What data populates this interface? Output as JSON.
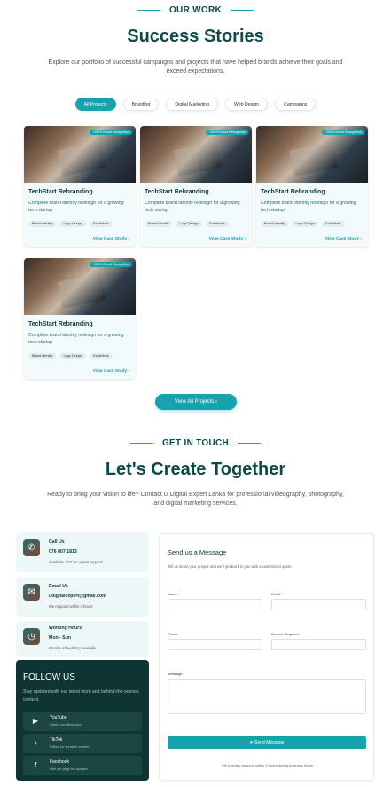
{
  "work": {
    "eyebrow": "OUR WORK",
    "title": "Success Stories",
    "lead": "Explore our portfolio of successful campaigns and projects that have helped brands achieve their goals and exceed expectations."
  },
  "filters": [
    "All Projects",
    "Branding",
    "Digital Marketing",
    "Web Design",
    "Campaigns"
  ],
  "cards": [
    {
      "tag": "+150% Brand Recognition",
      "title": "TechStart Rebranding",
      "desc": "Complete brand identity redesign for a growing tech startup",
      "chips": [
        "Brand Identity",
        "Logo Design",
        "Guidelines"
      ],
      "link": "View Case Study ›"
    },
    {
      "tag": "+150% Brand Recognition",
      "title": "TechStart Rebranding",
      "desc": "Complete brand identity redesign for a growing tech startup",
      "chips": [
        "Brand Identity",
        "Logo Design",
        "Guidelines"
      ],
      "link": "View Case Study ›"
    },
    {
      "tag": "+150% Brand Recognition",
      "title": "TechStart Rebranding",
      "desc": "Complete brand identity redesign for a growing tech startup",
      "chips": [
        "Brand Identity",
        "Logo Design",
        "Guidelines"
      ],
      "link": "View Case Study ›"
    },
    {
      "tag": "+150% Brand Recognition",
      "title": "TechStart Rebranding",
      "desc": "Complete brand identity redesign for a growing tech startup",
      "chips": [
        "Brand Identity",
        "Logo Design",
        "Guidelines"
      ],
      "link": "View Case Study ›"
    }
  ],
  "view_all": "View All Projects ›",
  "contact": {
    "eyebrow": "GET IN TOUCH",
    "title": "Let's Create Together",
    "lead": "Ready to bring your vision to life? Contact U Digital Expert Lanka for professional videography, photography, and digital marketing services."
  },
  "info": [
    {
      "icon": "phone-icon",
      "glyph": "✆",
      "title": "Call Us",
      "value": "076 807 1813",
      "sub": "Available 24/7 for urgent projects"
    },
    {
      "icon": "mail-icon",
      "glyph": "✉",
      "title": "Email Us",
      "value": "udigitalexpert@gmail.com",
      "sub": "We respond within 2 hours"
    },
    {
      "icon": "clock-icon",
      "glyph": "◷",
      "title": "Working Hours",
      "value": "Mon - Sun",
      "sub": "Flexible scheduling available"
    }
  ],
  "follow": {
    "title": "FOLLOW US",
    "desc": "Stay updated with our latest work and behind-the-scenes content.",
    "items": [
      {
        "icon": "youtube-icon",
        "glyph": "▶",
        "name": "YouTube",
        "sub": "Watch our latest work"
      },
      {
        "icon": "tiktok-icon",
        "glyph": "♪",
        "name": "TikTok",
        "sub": "Follow for creative content"
      },
      {
        "icon": "facebook-icon",
        "glyph": "f",
        "name": "Facebook",
        "sub": "Like our page for updates"
      }
    ]
  },
  "form": {
    "title": "Send us a Message",
    "sub": "Tell us about your project and we'll get back to you with a customized quote.",
    "name_label": "Name *",
    "email_label": "Email *",
    "phone_label": "Phone",
    "service_label": "Service Required",
    "message_label": "Message *",
    "send": "Send Message",
    "note": "We typically respond within 2 hours during business hours"
  },
  "colors": {
    "accent": "#18a2ad",
    "dark": "#0d4a4a",
    "follow_bg": "#0e3533"
  }
}
